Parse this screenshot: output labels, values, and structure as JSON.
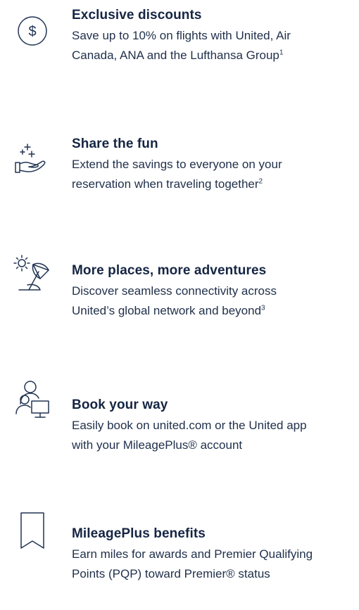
{
  "benefits": [
    {
      "icon": "dollar-circle-icon",
      "title": "Exclusive discounts",
      "line1": "Save up to 10% on flights with United, Air",
      "line2": "Canada, ANA and the Lufthansa Group",
      "footnote": "1"
    },
    {
      "icon": "hand-sparkles-icon",
      "title": "Share the fun",
      "line1": "Extend the savings to everyone on your",
      "line2": "reservation when traveling together",
      "footnote": "2"
    },
    {
      "icon": "beach-umbrella-icon",
      "title": "More places, more adventures",
      "line1": "Discover seamless connectivity across",
      "line2": "United’s global network and beyond",
      "footnote": "3"
    },
    {
      "icon": "user-computer-icon",
      "title": "Book your way",
      "line1": "Easily book on united.com or the United app",
      "line2": "with your MileagePlus® account",
      "footnote": ""
    },
    {
      "icon": "bookmark-icon",
      "title": "MileagePlus benefits",
      "line1": "Earn miles for awards and Premier Qualifying",
      "line2": "Points (PQP) toward Premier® status",
      "footnote": ""
    }
  ],
  "colors": {
    "text": "#152543",
    "icon_stroke": "#223453",
    "background": "#ffffff"
  }
}
